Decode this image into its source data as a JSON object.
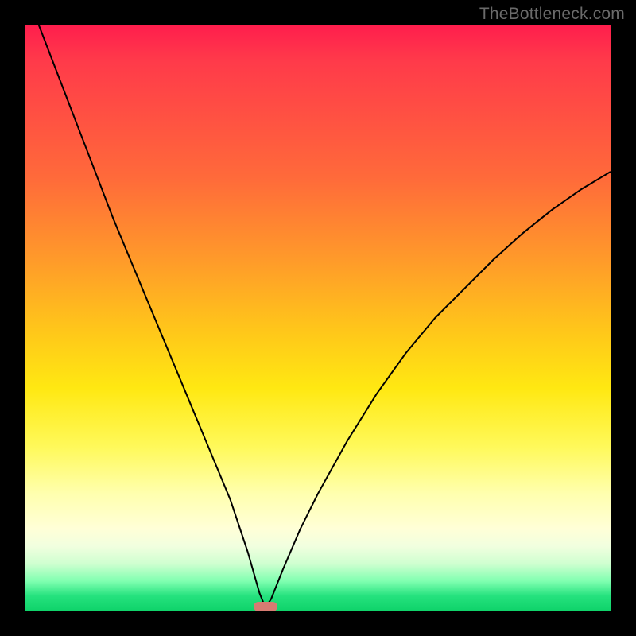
{
  "watermark": "TheBottleneck.com",
  "colors": {
    "frame": "#000000",
    "gradient_top": "#ff1e4d",
    "gradient_mid": "#ffe812",
    "gradient_bottom": "#0fd36a",
    "curve": "#000000",
    "marker": "#d77b72"
  },
  "chart_data": {
    "type": "line",
    "title": "",
    "xlabel": "",
    "ylabel": "",
    "xlim": [
      0,
      100
    ],
    "ylim": [
      0,
      100
    ],
    "notes": "Background vertical gradient runs from red (high bottleneck) at top through orange and yellow to green (no bottleneck) at bottom. A V-shaped black curve reaches its minimum (~0) near x≈41. A small rounded red marker sits at the curve's minimum on the x-axis.",
    "series": [
      {
        "name": "bottleneck-curve",
        "x": [
          0,
          5,
          10,
          15,
          20,
          25,
          30,
          35,
          38,
          40,
          41,
          42,
          44,
          47,
          50,
          55,
          60,
          65,
          70,
          75,
          80,
          85,
          90,
          95,
          100
        ],
        "values": [
          106,
          93,
          80,
          67,
          55,
          43,
          31,
          19,
          10,
          3,
          0.5,
          2,
          7,
          14,
          20,
          29,
          37,
          44,
          50,
          55,
          60,
          64.5,
          68.5,
          72,
          75
        ]
      }
    ],
    "marker": {
      "x": 41,
      "y": 0.5
    }
  }
}
